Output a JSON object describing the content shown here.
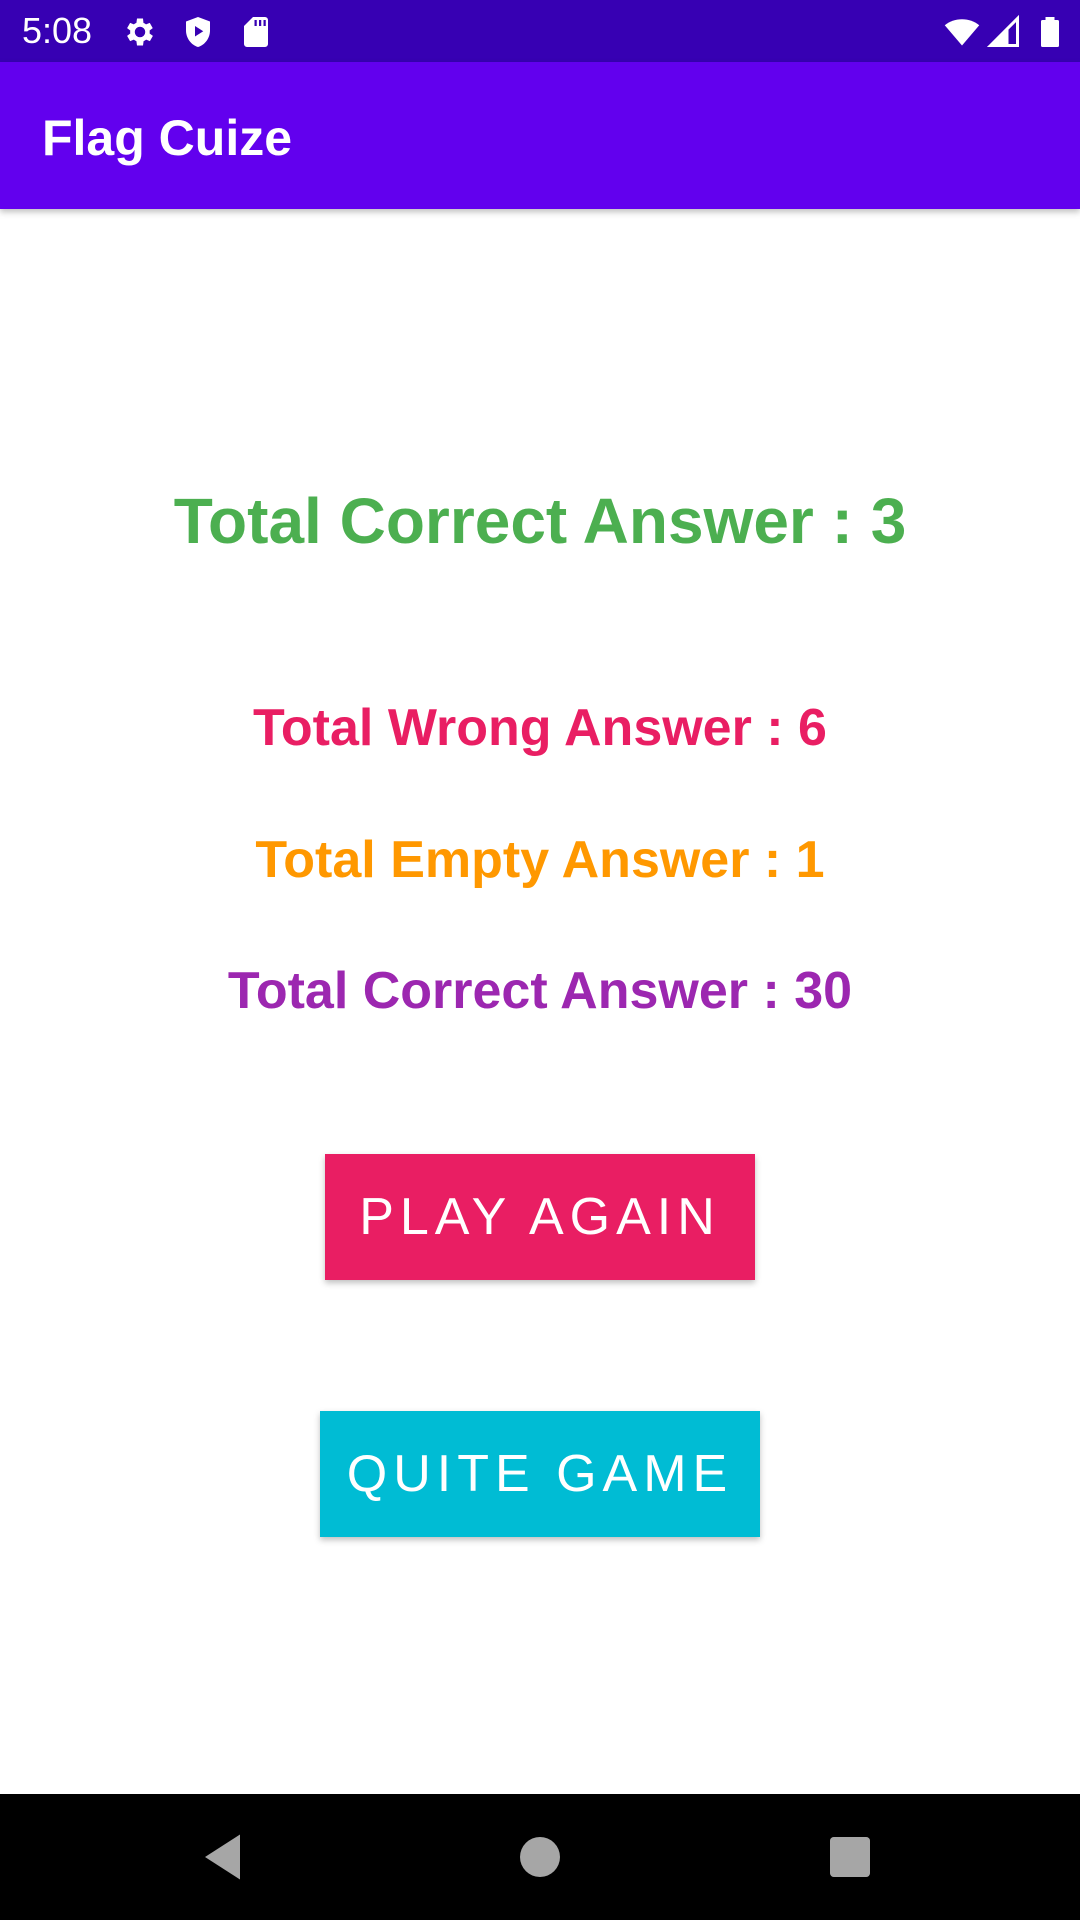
{
  "status_bar": {
    "time": "5:08",
    "icons": [
      "gear-icon",
      "shield-play-icon",
      "sd-card-icon",
      "wifi-icon",
      "cell-signal-icon",
      "battery-icon"
    ],
    "background": "#3700b3"
  },
  "app_bar": {
    "title": "Flag Cuize",
    "background": "#6200ee"
  },
  "results": {
    "correct": {
      "text": "Total Correct Answer : 3",
      "color": "#4caf50"
    },
    "wrong": {
      "text": "Total Wrong Answer : 6",
      "color": "#e91e63"
    },
    "empty": {
      "text": "Total Empty Answer : 1",
      "color": "#ff9800"
    },
    "score": {
      "text": "Total Correct Answer : 30",
      "color": "#9c27b0"
    }
  },
  "buttons": {
    "play_again": {
      "label": "PLAY AGAIN",
      "color": "#e91e63"
    },
    "quit_game": {
      "label": "QUITE GAME",
      "color": "#00bcd4"
    }
  },
  "nav_bar": {
    "icons": [
      "back-icon",
      "home-icon",
      "recents-icon"
    ],
    "background": "#000000"
  }
}
